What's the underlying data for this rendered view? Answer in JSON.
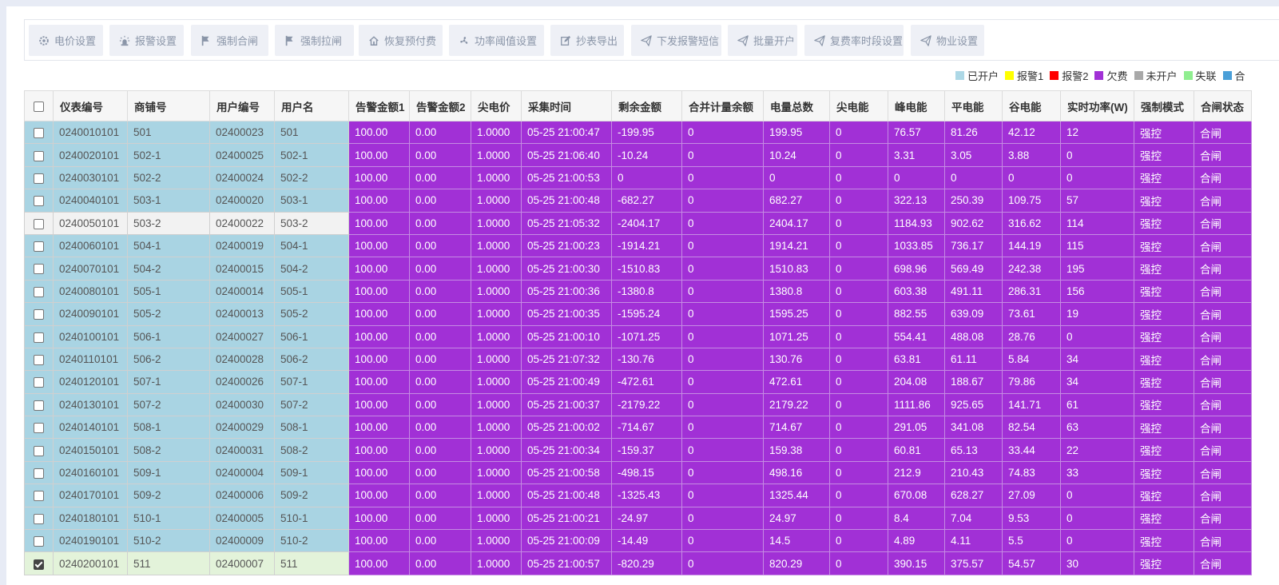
{
  "toolbar": {
    "buttons": [
      {
        "label": "电价设置",
        "icon": "gear-icon"
      },
      {
        "label": "报警设置",
        "icon": "alarm-icon"
      },
      {
        "label": "强制合闸",
        "icon": "flag-icon"
      },
      {
        "label": "强制拉闸",
        "icon": "flag-icon"
      },
      {
        "label": "恢复预付费",
        "icon": "home-icon"
      },
      {
        "label": "功率阈值设置",
        "icon": "fan-icon"
      },
      {
        "label": "抄表导出",
        "icon": "edit-icon"
      },
      {
        "label": "下发报警短信",
        "icon": "send-icon"
      },
      {
        "label": "批量开户",
        "icon": "send-icon"
      },
      {
        "label": "复费率时段设置",
        "icon": "send-icon"
      },
      {
        "label": "物业设置",
        "icon": "send-icon"
      }
    ]
  },
  "legend": [
    {
      "label": "已开户",
      "color": "#add8e6"
    },
    {
      "label": "报警1",
      "color": "#ffff00"
    },
    {
      "label": "报警2",
      "color": "#ff0000"
    },
    {
      "label": "欠费",
      "color": "#a130d6"
    },
    {
      "label": "未开户",
      "color": "#a9a9a9"
    },
    {
      "label": "失联",
      "color": "#90ee90"
    },
    {
      "label": "合",
      "color": "#4a9fd8"
    }
  ],
  "table": {
    "columns": [
      "仪表编号",
      "商铺号",
      "用户编号",
      "用户名",
      "告警金额1",
      "告警金额2",
      "尖电价",
      "采集时间",
      "剩余金额",
      "合并计量余额",
      "电量总数",
      "尖电能",
      "峰电能",
      "平电能",
      "谷电能",
      "实时功率(W)",
      "强制模式",
      "合闸状态"
    ],
    "rows": [
      {
        "status": "blue",
        "checked": false,
        "cells": [
          "0240010101",
          "501",
          "02400023",
          "501",
          "100.00",
          "0.00",
          "1.0000",
          "05-25 21:00:47",
          "-199.95",
          "0",
          "199.95",
          "0",
          "76.57",
          "81.26",
          "42.12",
          "12",
          "强控",
          "合闸"
        ]
      },
      {
        "status": "blue",
        "checked": false,
        "cells": [
          "0240020101",
          "502-1",
          "02400025",
          "502-1",
          "100.00",
          "0.00",
          "1.0000",
          "05-25 21:06:40",
          "-10.24",
          "0",
          "10.24",
          "0",
          "3.31",
          "3.05",
          "3.88",
          "0",
          "强控",
          "合闸"
        ]
      },
      {
        "status": "blue",
        "checked": false,
        "cells": [
          "0240030101",
          "502-2",
          "02400024",
          "502-2",
          "100.00",
          "0.00",
          "1.0000",
          "05-25 21:00:53",
          "0",
          "0",
          "0",
          "0",
          "0",
          "0",
          "0",
          "0",
          "强控",
          "合闸"
        ]
      },
      {
        "status": "blue",
        "checked": false,
        "cells": [
          "0240040101",
          "503-1",
          "02400020",
          "503-1",
          "100.00",
          "0.00",
          "1.0000",
          "05-25 21:00:48",
          "-682.27",
          "0",
          "682.27",
          "0",
          "322.13",
          "250.39",
          "109.75",
          "57",
          "强控",
          "合闸"
        ]
      },
      {
        "status": "grey",
        "checked": false,
        "cells": [
          "0240050101",
          "503-2",
          "02400022",
          "503-2",
          "100.00",
          "0.00",
          "1.0000",
          "05-25 21:05:32",
          "-2404.17",
          "0",
          "2404.17",
          "0",
          "1184.93",
          "902.62",
          "316.62",
          "114",
          "强控",
          "合闸"
        ]
      },
      {
        "status": "blue",
        "checked": false,
        "cells": [
          "0240060101",
          "504-1",
          "02400019",
          "504-1",
          "100.00",
          "0.00",
          "1.0000",
          "05-25 21:00:23",
          "-1914.21",
          "0",
          "1914.21",
          "0",
          "1033.85",
          "736.17",
          "144.19",
          "115",
          "强控",
          "合闸"
        ]
      },
      {
        "status": "blue",
        "checked": false,
        "cells": [
          "0240070101",
          "504-2",
          "02400015",
          "504-2",
          "100.00",
          "0.00",
          "1.0000",
          "05-25 21:00:30",
          "-1510.83",
          "0",
          "1510.83",
          "0",
          "698.96",
          "569.49",
          "242.38",
          "195",
          "强控",
          "合闸"
        ]
      },
      {
        "status": "blue",
        "checked": false,
        "cells": [
          "0240080101",
          "505-1",
          "02400014",
          "505-1",
          "100.00",
          "0.00",
          "1.0000",
          "05-25 21:00:36",
          "-1380.8",
          "0",
          "1380.8",
          "0",
          "603.38",
          "491.11",
          "286.31",
          "156",
          "强控",
          "合闸"
        ]
      },
      {
        "status": "blue",
        "checked": false,
        "cells": [
          "0240090101",
          "505-2",
          "02400013",
          "505-2",
          "100.00",
          "0.00",
          "1.0000",
          "05-25 21:00:35",
          "-1595.24",
          "0",
          "1595.25",
          "0",
          "882.55",
          "639.09",
          "73.61",
          "19",
          "强控",
          "合闸"
        ]
      },
      {
        "status": "blue",
        "checked": false,
        "cells": [
          "0240100101",
          "506-1",
          "02400027",
          "506-1",
          "100.00",
          "0.00",
          "1.0000",
          "05-25 21:00:10",
          "-1071.25",
          "0",
          "1071.25",
          "0",
          "554.41",
          "488.08",
          "28.76",
          "0",
          "强控",
          "合闸"
        ]
      },
      {
        "status": "blue",
        "checked": false,
        "cells": [
          "0240110101",
          "506-2",
          "02400028",
          "506-2",
          "100.00",
          "0.00",
          "1.0000",
          "05-25 21:07:32",
          "-130.76",
          "0",
          "130.76",
          "0",
          "63.81",
          "61.11",
          "5.84",
          "34",
          "强控",
          "合闸"
        ]
      },
      {
        "status": "blue",
        "checked": false,
        "cells": [
          "0240120101",
          "507-1",
          "02400026",
          "507-1",
          "100.00",
          "0.00",
          "1.0000",
          "05-25 21:00:49",
          "-472.61",
          "0",
          "472.61",
          "0",
          "204.08",
          "188.67",
          "79.86",
          "34",
          "强控",
          "合闸"
        ]
      },
      {
        "status": "blue",
        "checked": false,
        "cells": [
          "0240130101",
          "507-2",
          "02400030",
          "507-2",
          "100.00",
          "0.00",
          "1.0000",
          "05-25 21:00:37",
          "-2179.22",
          "0",
          "2179.22",
          "0",
          "1111.86",
          "925.65",
          "141.71",
          "61",
          "强控",
          "合闸"
        ]
      },
      {
        "status": "blue",
        "checked": false,
        "cells": [
          "0240140101",
          "508-1",
          "02400029",
          "508-1",
          "100.00",
          "0.00",
          "1.0000",
          "05-25 21:00:02",
          "-714.67",
          "0",
          "714.67",
          "0",
          "291.05",
          "341.08",
          "82.54",
          "63",
          "强控",
          "合闸"
        ]
      },
      {
        "status": "blue",
        "checked": false,
        "cells": [
          "0240150101",
          "508-2",
          "02400031",
          "508-2",
          "100.00",
          "0.00",
          "1.0000",
          "05-25 21:00:34",
          "-159.37",
          "0",
          "159.38",
          "0",
          "60.81",
          "65.13",
          "33.44",
          "22",
          "强控",
          "合闸"
        ]
      },
      {
        "status": "blue",
        "checked": false,
        "cells": [
          "0240160101",
          "509-1",
          "02400004",
          "509-1",
          "100.00",
          "0.00",
          "1.0000",
          "05-25 21:00:58",
          "-498.15",
          "0",
          "498.16",
          "0",
          "212.9",
          "210.43",
          "74.83",
          "33",
          "强控",
          "合闸"
        ]
      },
      {
        "status": "blue",
        "checked": false,
        "cells": [
          "0240170101",
          "509-2",
          "02400006",
          "509-2",
          "100.00",
          "0.00",
          "1.0000",
          "05-25 21:00:48",
          "-1325.43",
          "0",
          "1325.44",
          "0",
          "670.08",
          "628.27",
          "27.09",
          "0",
          "强控",
          "合闸"
        ]
      },
      {
        "status": "blue",
        "checked": false,
        "cells": [
          "0240180101",
          "510-1",
          "02400005",
          "510-1",
          "100.00",
          "0.00",
          "1.0000",
          "05-25 21:00:21",
          "-24.97",
          "0",
          "24.97",
          "0",
          "8.4",
          "7.04",
          "9.53",
          "0",
          "强控",
          "合闸"
        ]
      },
      {
        "status": "blue",
        "checked": false,
        "cells": [
          "0240190101",
          "510-2",
          "02400009",
          "510-2",
          "100.00",
          "0.00",
          "1.0000",
          "05-25 21:00:09",
          "-14.49",
          "0",
          "14.5",
          "0",
          "4.89",
          "4.11",
          "5.5",
          "0",
          "强控",
          "合闸"
        ]
      },
      {
        "status": "green",
        "checked": true,
        "cells": [
          "0240200101",
          "511",
          "02400007",
          "511",
          "100.00",
          "0.00",
          "1.0000",
          "05-25 21:00:57",
          "-820.29",
          "0",
          "820.29",
          "0",
          "390.15",
          "375.57",
          "54.57",
          "30",
          "强控",
          "合闸"
        ]
      }
    ]
  }
}
